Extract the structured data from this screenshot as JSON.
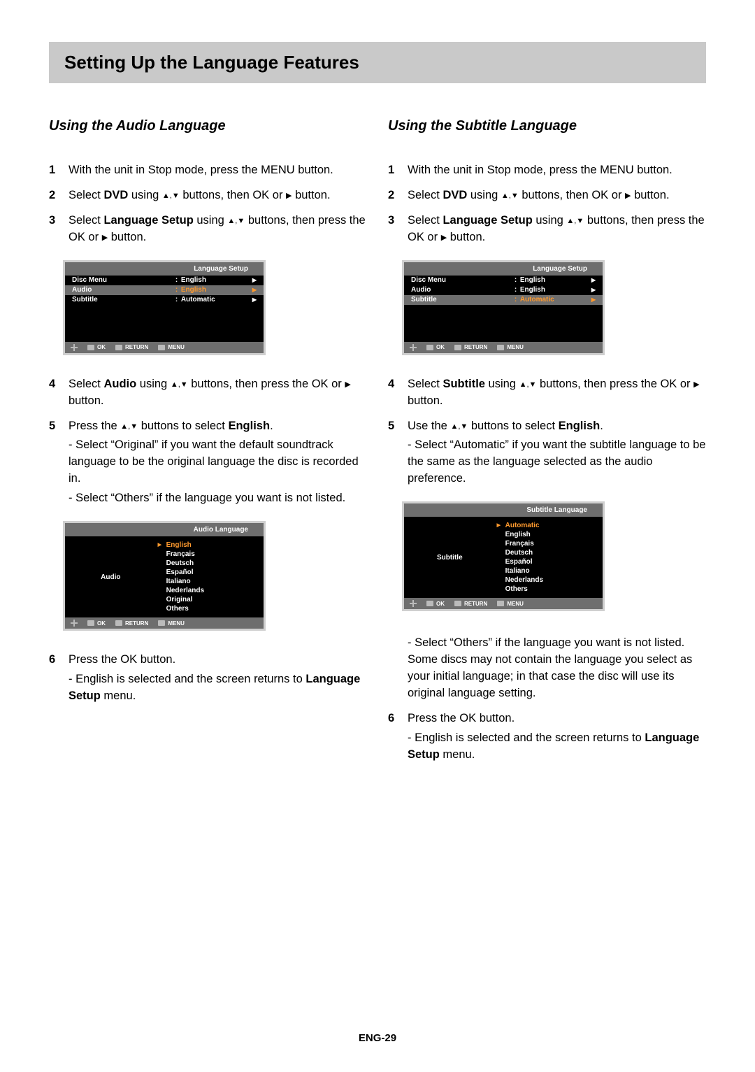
{
  "page_title": "Setting Up the Language Features",
  "page_number": "ENG-29",
  "left": {
    "heading": "Using the Audio Language",
    "steps": {
      "s1": "With the unit in Stop mode, press the MENU button.",
      "s2a": "Select ",
      "s2b": "DVD",
      "s2c": " using ",
      "s2d": " buttons, then OK or ",
      "s2e": " button.",
      "s3a": "Select ",
      "s3b": "Language Setup",
      "s3c": " using ",
      "s3d": " buttons, then press the OK or ",
      "s3e": " button.",
      "s4a": "Select ",
      "s4b": "Audio",
      "s4c": " using ",
      "s4d": " buttons, then press the OK or ",
      "s4e": "button.",
      "s5a": "Press the ",
      "s5b": " buttons to select ",
      "s5c": "English",
      "s5d": ".",
      "s5n1": "- Select “Original” if you want the default soundtrack language to be the original language the disc is recorded in.",
      "s5n2": "- Select “Others” if the language you want is not listed.",
      "s6a": "Press the OK button.",
      "s6n1a": "- English is selected and the screen returns to ",
      "s6n1b": "Language Setup",
      "s6n1c": " menu."
    },
    "osd1": {
      "title": "Language Setup",
      "rows": [
        {
          "label": "Disc Menu",
          "value": "English",
          "hl": false
        },
        {
          "label": "Audio",
          "value": "English",
          "hl": true
        },
        {
          "label": "Subtitle",
          "value": "Automatic",
          "hl": false
        }
      ],
      "footer": [
        "OK",
        "RETURN",
        "MENU"
      ]
    },
    "osd2": {
      "title": "Audio Language",
      "label": "Audio",
      "options": [
        "English",
        "Français",
        "Deutsch",
        "Español",
        "Italiano",
        "Nederlands",
        "Original",
        "Others"
      ],
      "selected": "English",
      "footer": [
        "OK",
        "RETURN",
        "MENU"
      ]
    }
  },
  "right": {
    "heading": "Using the Subtitle Language",
    "steps": {
      "s1": "With the unit in Stop mode, press the MENU button.",
      "s2a": "Select ",
      "s2b": "DVD",
      "s2c": " using ",
      "s2d": " buttons, then OK or ",
      "s2e": " button.",
      "s3a": "Select ",
      "s3b": "Language Setup",
      "s3c": " using ",
      "s3d": " buttons, then press the OK or ",
      "s3e": " button.",
      "s4a": "Select ",
      "s4b": "Subtitle",
      "s4c": " using ",
      "s4d": " buttons, then press the OK or ",
      "s4e": " button.",
      "s5a": "Use the ",
      "s5b": " buttons to select ",
      "s5c": "English",
      "s5d": ".",
      "s5n1": "- Select “Automatic” if you want the subtitle language to be the same as the language selected as the audio preference.",
      "s5n2": "- Select “Others” if the language you want is not listed. Some discs may not contain the language you select as your initial language; in that case the disc will use its original language setting.",
      "s6a": "Press the OK button.",
      "s6n1a": "- English is selected and the screen returns to ",
      "s6n1b": "Language Setup",
      "s6n1c": " menu."
    },
    "osd1": {
      "title": "Language Setup",
      "rows": [
        {
          "label": "Disc Menu",
          "value": "English",
          "hl": false
        },
        {
          "label": "Audio",
          "value": "English",
          "hl": false
        },
        {
          "label": "Subtitle",
          "value": "Automatic",
          "hl": true
        }
      ],
      "footer": [
        "OK",
        "RETURN",
        "MENU"
      ]
    },
    "osd2": {
      "title": "Subtitle Language",
      "label": "Subtitle",
      "options": [
        "Automatic",
        "English",
        "Français",
        "Deutsch",
        "Español",
        "Italiano",
        "Nederlands",
        "Others"
      ],
      "selected": "Automatic",
      "footer": [
        "OK",
        "RETURN",
        "MENU"
      ]
    }
  },
  "glyphs": {
    "updown": "▲,▼",
    "right": "▶"
  }
}
